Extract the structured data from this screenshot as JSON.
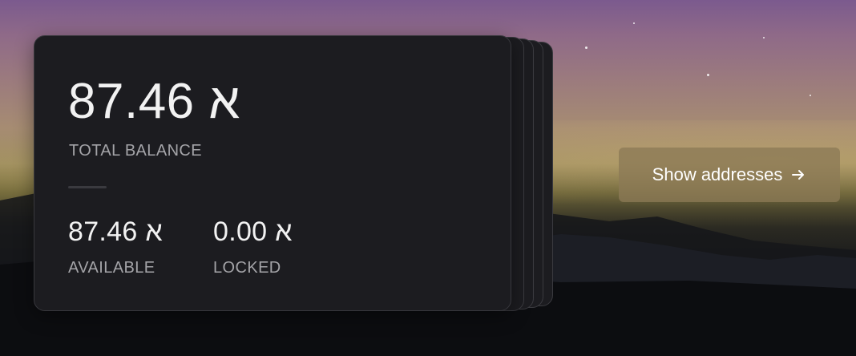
{
  "wallet": {
    "total_balance": "87.46 א",
    "total_label": "TOTAL BALANCE",
    "available_amount": "87.46 א",
    "available_label": "AVAILABLE",
    "locked_amount": "0.00 א",
    "locked_label": "LOCKED"
  },
  "actions": {
    "show_addresses_label": "Show addresses",
    "show_addresses_icon": "arrow-right-icon"
  },
  "colors": {
    "card_background": "#1c1c20",
    "card_border": "#38383d",
    "text_primary": "#f2f2f2",
    "text_secondary": "#a4a4a8",
    "button_background": "#8c7a56"
  }
}
